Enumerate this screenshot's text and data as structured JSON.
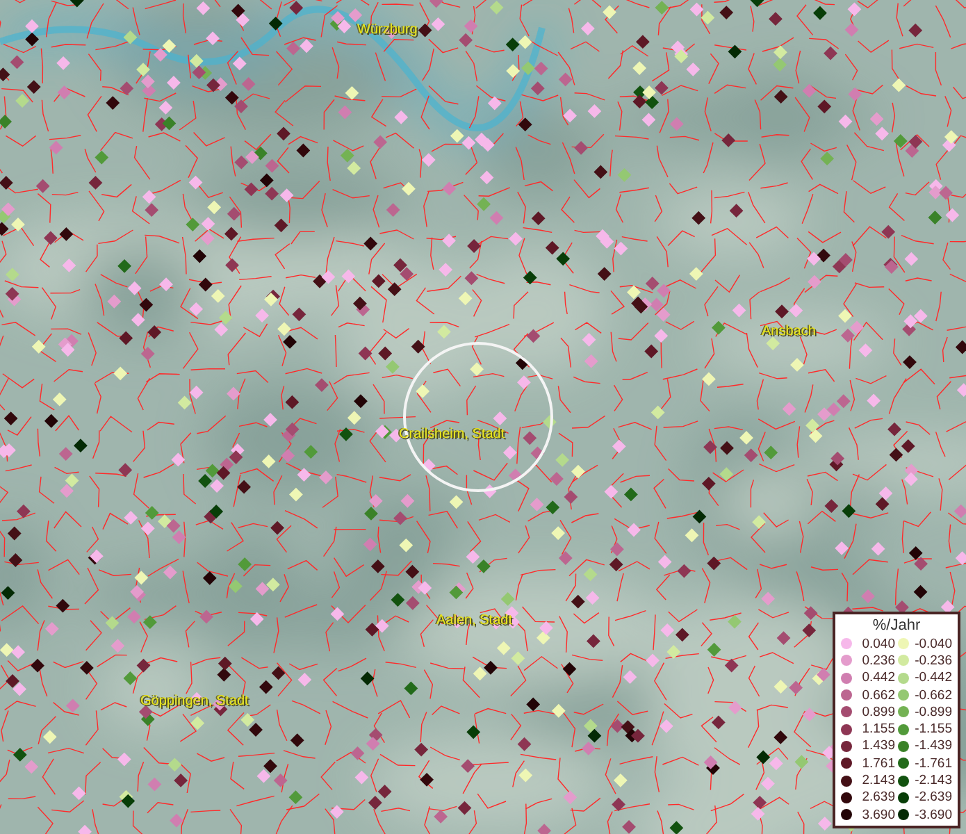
{
  "map": {
    "places": [
      {
        "name": "Würzburg"
      },
      {
        "name": "Ansbach"
      },
      {
        "name": "Crailsheim, Stadt"
      },
      {
        "name": "Aalen, Stadt"
      },
      {
        "name": "Göppingen, Stadt"
      }
    ]
  },
  "legend": {
    "title": "%/Jahr",
    "items": [
      {
        "value": "0.040",
        "color": "#f6b8ea"
      },
      {
        "value": "-0.040",
        "color": "#eef6b4"
      },
      {
        "value": "0.236",
        "color": "#e49ccc"
      },
      {
        "value": "-0.236",
        "color": "#d2eaa0"
      },
      {
        "value": "0.442",
        "color": "#d07eb0"
      },
      {
        "value": "-0.442",
        "color": "#b4da8c"
      },
      {
        "value": "0.662",
        "color": "#bc6690"
      },
      {
        "value": "-0.662",
        "color": "#94c872"
      },
      {
        "value": "0.899",
        "color": "#a44c70"
      },
      {
        "value": "-0.899",
        "color": "#74b254"
      },
      {
        "value": "1.155",
        "color": "#8e3654"
      },
      {
        "value": "-1.155",
        "color": "#529a3a"
      },
      {
        "value": "1.439",
        "color": "#76263c"
      },
      {
        "value": "-1.439",
        "color": "#3a8228"
      },
      {
        "value": "1.761",
        "color": "#5e1826"
      },
      {
        "value": "-1.761",
        "color": "#226a1a"
      },
      {
        "value": "2.143",
        "color": "#441016"
      },
      {
        "value": "-2.143",
        "color": "#12520f"
      },
      {
        "value": "2.639",
        "color": "#32080c"
      },
      {
        "value": "-2.639",
        "color": "#083e08"
      },
      {
        "value": "3.690",
        "color": "#220406"
      },
      {
        "value": "-3.690",
        "color": "#042a04"
      }
    ]
  }
}
